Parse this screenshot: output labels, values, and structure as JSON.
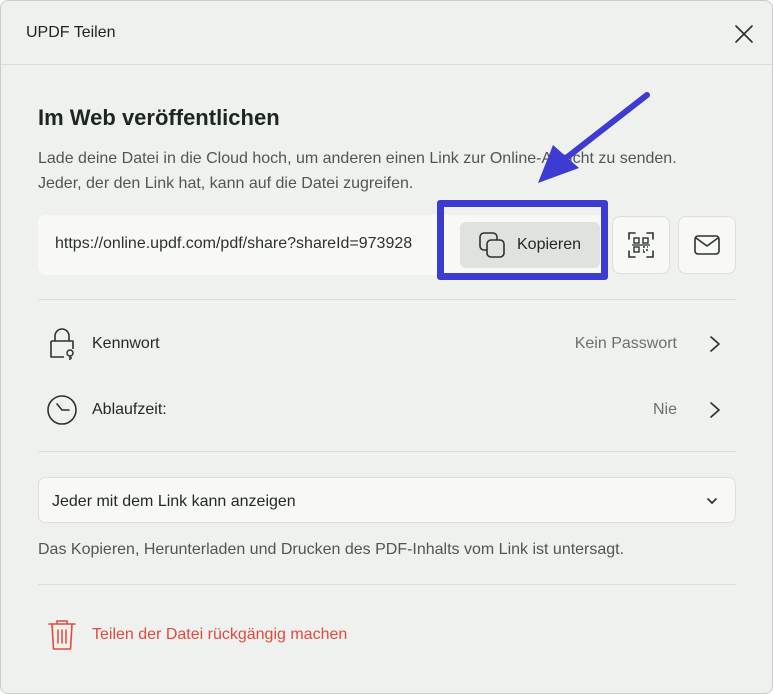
{
  "dialog": {
    "title": "UPDF Teilen"
  },
  "publish": {
    "heading": "Im Web veröffentlichen",
    "description": "Lade deine Datei in die Cloud hoch, um anderen einen Link zur Online-Ansicht zu senden. Jeder, der den Link hat, kann auf die Datei zugreifen.",
    "link_url": "https://online.updf.com/pdf/share?shareId=973928",
    "copy_label": "Kopieren"
  },
  "settings": {
    "password": {
      "label": "Kennwort",
      "value": "Kein Passwort"
    },
    "expiry": {
      "label": "Ablaufzeit:",
      "value": "Nie"
    }
  },
  "permission": {
    "selected": "Jeder mit dem Link kann anzeigen",
    "note": "Das Kopieren, Herunterladen und Drucken des PDF-Inhalts vom Link ist untersagt."
  },
  "stop_share": {
    "label": "Teilen der Datei rückgängig machen"
  },
  "icons": {
    "close": "close-icon",
    "copy": "copy-icon",
    "qr": "qr-code-icon",
    "mail": "mail-icon",
    "password": "lock-key-icon",
    "expiry": "clock-icon",
    "chevron_right": "chevron-right-icon",
    "chevron_down": "chevron-down-icon",
    "trash": "trash-icon"
  },
  "colors": {
    "accent_highlight": "#3d3bd1",
    "danger": "#e04a3f",
    "background": "#eff1ee"
  }
}
